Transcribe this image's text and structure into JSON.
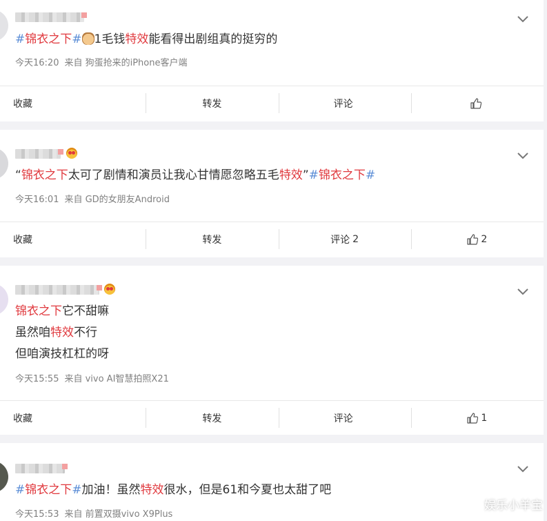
{
  "posts": [
    {
      "content_lines": [
        [
          {
            "text": "#",
            "cls": "topic"
          },
          {
            "text": "锦衣之下",
            "cls": "topic-name"
          },
          {
            "text": "#",
            "cls": "topic"
          },
          {
            "emoji": "cat-face-emoji"
          },
          {
            "text": "1毛钱",
            "cls": ""
          },
          {
            "text": "特效",
            "cls": "hl"
          },
          {
            "text": "能看得出剧组真的挺穷的",
            "cls": ""
          }
        ]
      ],
      "time": "今天16:20",
      "source": "来自 狗蛋抢来的iPhone客户端",
      "actions": {
        "fav": "收藏",
        "repost": "转发",
        "comment": "评论",
        "comment_count": "",
        "like_count": ""
      }
    },
    {
      "content_lines": [
        [
          {
            "text": "“",
            "cls": ""
          },
          {
            "text": "锦衣之下",
            "cls": "hl"
          },
          {
            "text": "太可了剧情和演员让我心甘情愿忽略五毛",
            "cls": ""
          },
          {
            "text": "特效",
            "cls": "hl"
          },
          {
            "text": "”",
            "cls": ""
          },
          {
            "text": "#",
            "cls": "topic"
          },
          {
            "text": "锦衣之下",
            "cls": "topic-name"
          },
          {
            "text": "#",
            "cls": "topic"
          }
        ]
      ],
      "time": "今天16:01",
      "source": "来自 GD的女朋友Android",
      "actions": {
        "fav": "收藏",
        "repost": "转发",
        "comment": "评论",
        "comment_count": "2",
        "like_count": "2"
      }
    },
    {
      "content_lines": [
        [
          {
            "text": "锦衣之下",
            "cls": "hl"
          },
          {
            "text": "它不甜嘛",
            "cls": ""
          }
        ],
        [
          {
            "text": "虽然咱",
            "cls": ""
          },
          {
            "text": "特效",
            "cls": "hl"
          },
          {
            "text": "不行",
            "cls": ""
          }
        ],
        [
          {
            "text": "但咱演技杠杠的呀",
            "cls": ""
          }
        ]
      ],
      "time": "今天15:55",
      "source": "来自 vivo AI智慧拍照X21",
      "actions": {
        "fav": "收藏",
        "repost": "转发",
        "comment": "评论",
        "comment_count": "",
        "like_count": "1"
      }
    },
    {
      "content_lines": [
        [
          {
            "text": "#",
            "cls": "topic"
          },
          {
            "text": "锦衣之下",
            "cls": "topic-name"
          },
          {
            "text": "#",
            "cls": "topic"
          },
          {
            "text": "加油！虽然",
            "cls": ""
          },
          {
            "text": "特效",
            "cls": "hl"
          },
          {
            "text": "很水，但是61和今夏也太甜了吧",
            "cls": ""
          }
        ]
      ],
      "time": "今天15:53",
      "source": "来自 前置双摄vivo X9Plus",
      "actions": {
        "fav": "收藏",
        "repost": "转发",
        "comment": "评论",
        "comment_count": "",
        "like_count": ""
      }
    }
  ],
  "watermark": "娱乐小羊宝",
  "icons": {
    "expand": "chevron-down-icon",
    "like": "thumbs-up-icon",
    "badge": "crown-badge-icon"
  }
}
